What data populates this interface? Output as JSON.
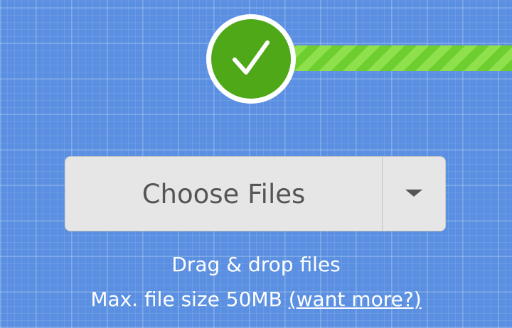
{
  "upload": {
    "status_icon": "checkmark-icon",
    "progress": 1.0,
    "accent_color": "#4ea818",
    "stripe_color": "#6fce2f",
    "background_color": "#5a8fe1"
  },
  "choose": {
    "label": "Choose Files",
    "dropdown_icon": "caret-down-icon"
  },
  "info": {
    "drag_text": "Drag & drop files",
    "max_prefix": "Max. file size 50MB ",
    "open_paren": "(",
    "want_more": "want more?",
    "close_paren": ")"
  }
}
